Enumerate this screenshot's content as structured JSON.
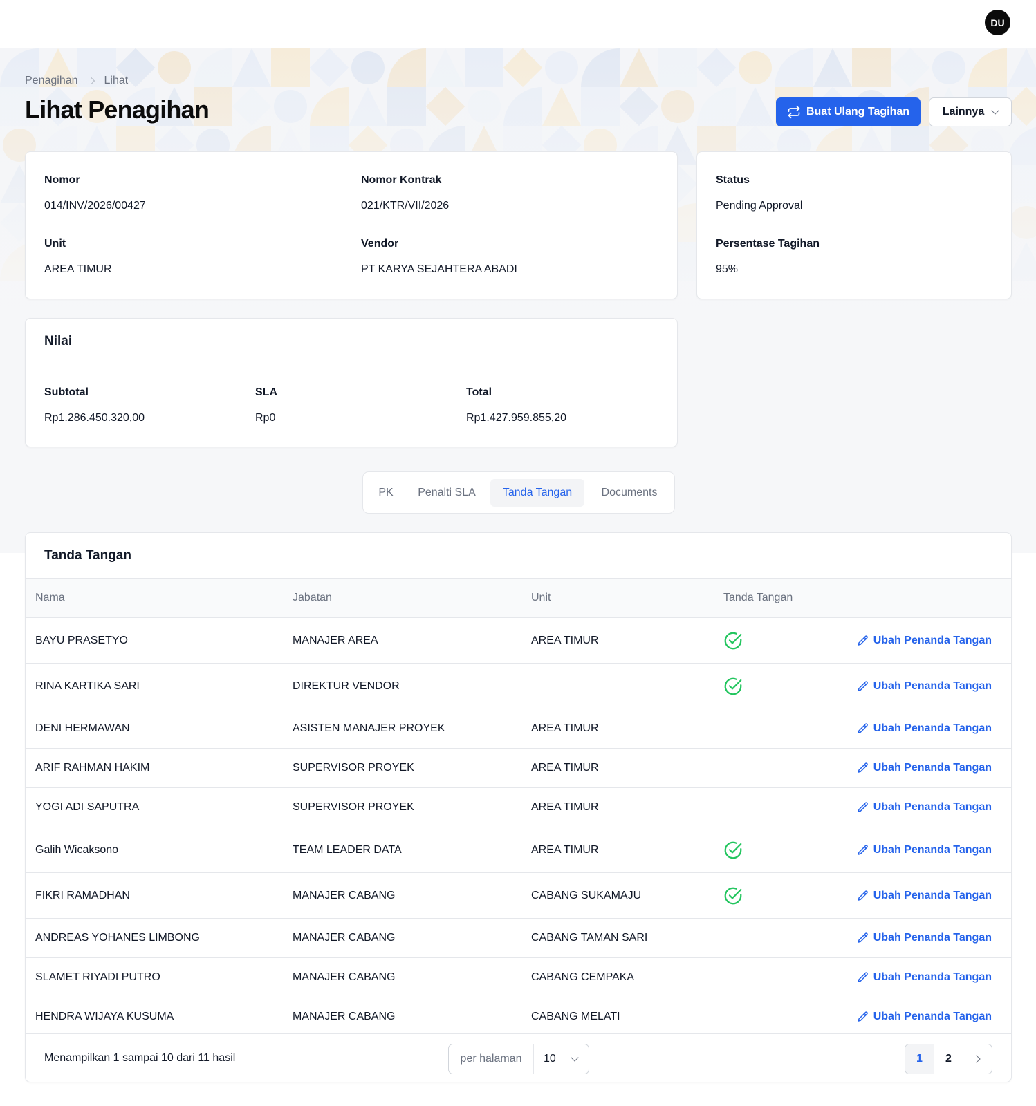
{
  "header": {
    "avatar_initials": "DU"
  },
  "breadcrumb": {
    "root": "Penagihan",
    "current": "Lihat"
  },
  "page": {
    "title": "Lihat Penagihan"
  },
  "actions": {
    "regenerate_label": "Buat Ulang Tagihan",
    "more_label": "Lainnya"
  },
  "info": {
    "nomor_label": "Nomor",
    "nomor_value": "014/INV/2026/00427",
    "kontrak_label": "Nomor Kontrak",
    "kontrak_value": "021/KTR/VII/2026",
    "unit_label": "Unit",
    "unit_value": "AREA TIMUR",
    "vendor_label": "Vendor",
    "vendor_value": "PT KARYA SEJAHTERA ABADI"
  },
  "status_card": {
    "status_label": "Status",
    "status_value": "Pending Approval",
    "percent_label": "Persentase Tagihan",
    "percent_value": "95%"
  },
  "nilai": {
    "title": "Nilai",
    "subtotal_label": "Subtotal",
    "subtotal_value": "Rp1.286.450.320,00",
    "sla_label": "SLA",
    "sla_value": "Rp0",
    "total_label": "Total",
    "total_value": "Rp1.427.959.855,20"
  },
  "tabs": [
    {
      "label": "PK"
    },
    {
      "label": "Penalti SLA"
    },
    {
      "label": "Tanda Tangan",
      "active": true
    },
    {
      "label": "Documents"
    }
  ],
  "signatures": {
    "title": "Tanda Tangan",
    "columns": [
      "Nama",
      "Jabatan",
      "Unit",
      "Tanda Tangan"
    ],
    "edit_label": "Ubah Penanda Tangan",
    "rows": [
      {
        "nama": "BAYU PRASETYO",
        "jabatan": "MANAJER AREA",
        "unit": "AREA TIMUR",
        "signed": true
      },
      {
        "nama": "RINA KARTIKA SARI",
        "jabatan": "DIREKTUR VENDOR",
        "unit": "",
        "signed": true
      },
      {
        "nama": "DENI HERMAWAN",
        "jabatan": "ASISTEN MANAJER PROYEK",
        "unit": "AREA TIMUR",
        "signed": false
      },
      {
        "nama": "ARIF RAHMAN HAKIM",
        "jabatan": "SUPERVISOR PROYEK",
        "unit": "AREA TIMUR",
        "signed": false
      },
      {
        "nama": "YOGI ADI SAPUTRA",
        "jabatan": "SUPERVISOR PROYEK",
        "unit": "AREA TIMUR",
        "signed": false
      },
      {
        "nama": "Galih Wicaksono",
        "jabatan": "TEAM LEADER DATA",
        "unit": "AREA TIMUR",
        "signed": true
      },
      {
        "nama": "FIKRI RAMADHAN",
        "jabatan": "MANAJER CABANG",
        "unit": "CABANG SUKAMAJU",
        "signed": true
      },
      {
        "nama": "ANDREAS YOHANES LIMBONG",
        "jabatan": "MANAJER CABANG",
        "unit": "CABANG TAMAN SARI",
        "signed": false
      },
      {
        "nama": "SLAMET RIYADI PUTRO",
        "jabatan": "MANAJER CABANG",
        "unit": "CABANG CEMPAKA",
        "signed": false
      },
      {
        "nama": "HENDRA WIJAYA KUSUMA",
        "jabatan": "MANAJER CABANG",
        "unit": "CABANG MELATI",
        "signed": false
      }
    ],
    "summary": "Menampilkan 1 sampai 10 dari 11 hasil",
    "per_page_label": "per halaman",
    "per_page_value": "10",
    "pages": [
      "1",
      "2"
    ],
    "current_page": "1"
  },
  "colors": {
    "accent": "#2563eb",
    "success": "#22c55e"
  }
}
